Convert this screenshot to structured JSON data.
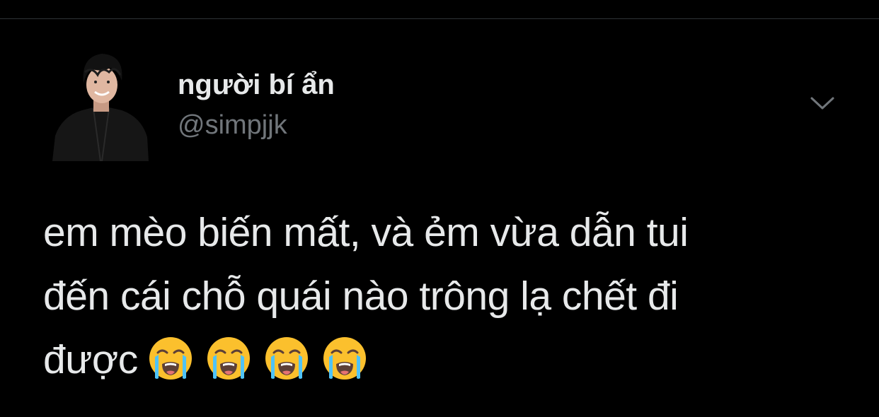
{
  "tweet": {
    "author": {
      "display_name": "người bí ẩn",
      "handle": "@simpjjk"
    },
    "text_lines": [
      "em mèo biến mất, và ẻm vừa dẫn tui",
      "đến cái chỗ quái nào trông lạ chết đi",
      "được"
    ],
    "emojis": [
      "loudly-crying-face",
      "loudly-crying-face",
      "loudly-crying-face",
      "loudly-crying-face"
    ]
  },
  "colors": {
    "background": "#000000",
    "primary_text": "#e7e9ea",
    "secondary_text": "#71767b",
    "divider": "#2f3336",
    "emoji_face": "#fbc02d",
    "emoji_tears": "#4fc3f7"
  },
  "icons": {
    "more": "chevron-down-icon",
    "avatar": "profile-photo"
  }
}
